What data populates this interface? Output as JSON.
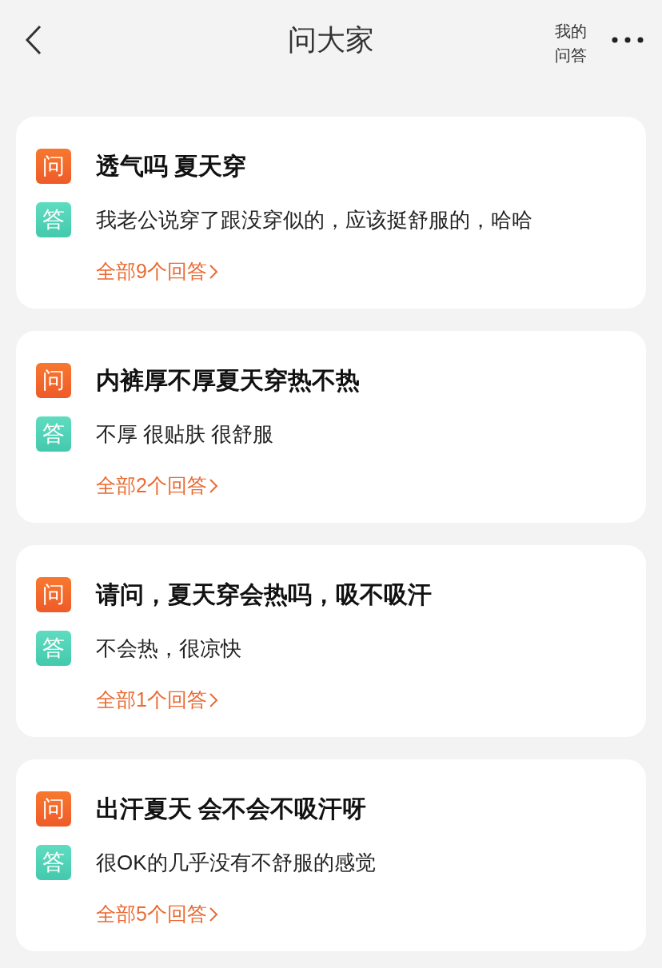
{
  "header": {
    "title": "问大家",
    "my_answers": "我的问答"
  },
  "questions": [
    {
      "badge_q": "问",
      "question": "透气吗 夏天穿",
      "badge_a": "答",
      "answer": "我老公说穿了跟没穿似的，应该挺舒服的，哈哈",
      "all_answers": "全部9个回答"
    },
    {
      "badge_q": "问",
      "question": "内裤厚不厚夏天穿热不热",
      "badge_a": "答",
      "answer": "不厚 很贴肤 很舒服",
      "all_answers": "全部2个回答"
    },
    {
      "badge_q": "问",
      "question": "请问，夏天穿会热吗，吸不吸汗",
      "badge_a": "答",
      "answer": "不会热，很凉快",
      "all_answers": "全部1个回答"
    },
    {
      "badge_q": "问",
      "question": "出汗夏天 会不会不吸汗呀",
      "badge_a": "答",
      "answer": "很OK的几乎没有不舒服的感觉",
      "all_answers": "全部5个回答"
    }
  ]
}
